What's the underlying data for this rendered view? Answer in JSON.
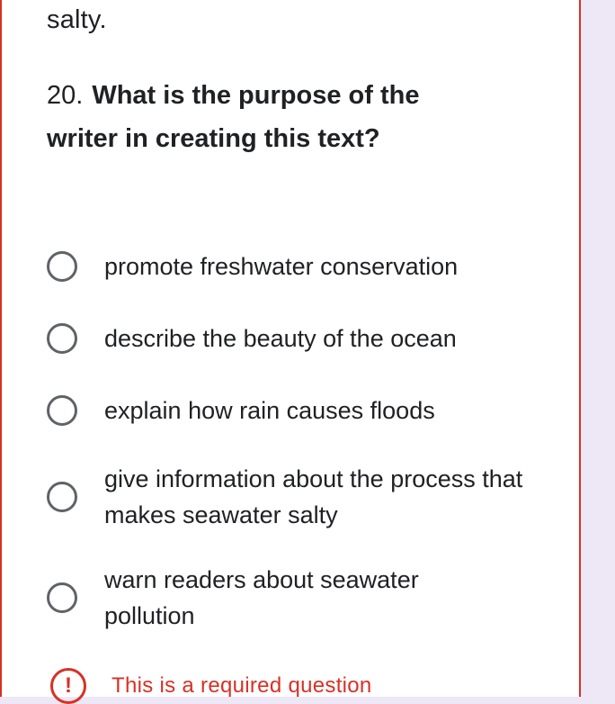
{
  "previous_text": "salty.",
  "question": {
    "number": "20.",
    "text": "What is the purpose of the writer in creating this text?"
  },
  "options": [
    {
      "label": "promote freshwater conservation"
    },
    {
      "label": "describe the beauty of the ocean"
    },
    {
      "label": "explain how rain causes floods"
    },
    {
      "label": "give information about the process that makes seawater salty"
    },
    {
      "label": "warn readers about seawater pollution"
    }
  ],
  "validation": {
    "icon": "error-icon",
    "icon_glyph": "!",
    "message": "This is a required question"
  },
  "colors": {
    "error": "#d93025",
    "radio": "#5f6368",
    "text": "#202124",
    "page_background": "#ede7f6"
  }
}
